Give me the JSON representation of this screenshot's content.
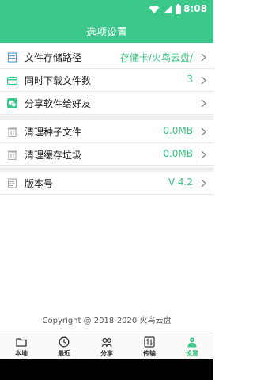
{
  "status_bar": {
    "time": "8:08",
    "icons": [
      "wifi-icon",
      "signal-icon",
      "battery-icon"
    ]
  },
  "app_bar": {
    "title": "选项设置"
  },
  "settings": [
    {
      "icon": "folder-path-icon",
      "label": "文件存储路径",
      "value": "存储卡/火鸟云盘/"
    },
    {
      "icon": "download-count-icon",
      "label": "同时下载文件数",
      "value": "3"
    },
    {
      "icon": "wechat-share-icon",
      "label": "分享软件给好友",
      "value": ""
    },
    {
      "icon": "trash-seed-icon",
      "label": "清理种子文件",
      "value": "0.0MB"
    },
    {
      "icon": "trash-cache-icon",
      "label": "清理缓存垃圾",
      "value": "0.0MB"
    },
    {
      "icon": "version-icon",
      "label": "版本号",
      "value": "V 4.2"
    }
  ],
  "footer": {
    "copyright": "Copyright @ 2018-2020 火鸟云盘"
  },
  "tabs": [
    {
      "icon": "folder-icon",
      "label": "本地",
      "active": false
    },
    {
      "icon": "clock-icon",
      "label": "最近",
      "active": false
    },
    {
      "icon": "users-icon",
      "label": "分享",
      "active": false
    },
    {
      "icon": "transfer-icon",
      "label": "传输",
      "active": false
    },
    {
      "icon": "settings-user-icon",
      "label": "设置",
      "active": true
    }
  ],
  "colors": {
    "accent": "#3cc88a",
    "value_text": "#37c47f",
    "divider": "#f0f0f0"
  }
}
